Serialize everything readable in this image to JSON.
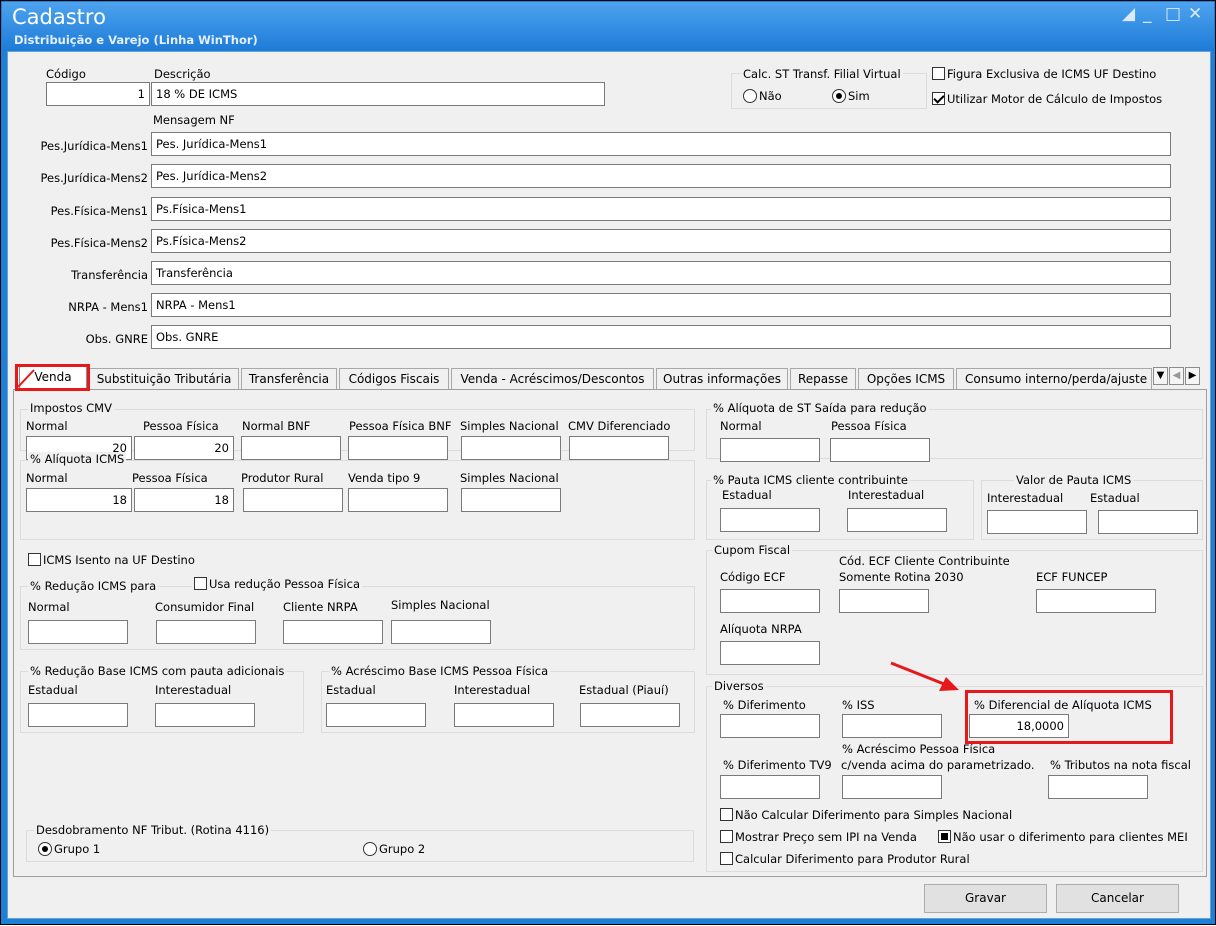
{
  "window": {
    "title": "Cadastro",
    "subtitle": "Distribuição e Varejo (Linha WinThor)"
  },
  "header": {
    "codigo_label": "Código",
    "codigo_value": "1",
    "descricao_label": "Descrição",
    "descricao_value": "18 % DE ICMS",
    "calc_st": {
      "label": "Calc. ST Transf. Filial Virtual",
      "options": [
        "Não",
        "Sim"
      ],
      "selected": "Sim"
    },
    "figura_exclusiva": {
      "label": "Figura Exclusiva de ICMS UF Destino",
      "checked": false
    },
    "utilizar_motor": {
      "label": "Utilizar Motor de Cálculo de Impostos",
      "checked": true
    },
    "mensagem_nf_label": "Mensagem NF"
  },
  "mensagens": [
    {
      "label": "Pes.Jurídica-Mens1",
      "value": "Pes. Jurídica-Mens1"
    },
    {
      "label": "Pes.Jurídica-Mens2",
      "value": "Pes. Jurídica-Mens2"
    },
    {
      "label": "Pes.Física-Mens1",
      "value": "Ps.Física-Mens1"
    },
    {
      "label": "Pes.Física-Mens2",
      "value": "Ps.Física-Mens2"
    },
    {
      "label": "Transferência",
      "value": "Transferência"
    },
    {
      "label": "NRPA - Mens1",
      "value": "NRPA - Mens1"
    },
    {
      "label": "Obs. GNRE",
      "value": "Obs. GNRE"
    }
  ],
  "tabs": [
    {
      "label": "Venda",
      "active": true
    },
    {
      "label": "Substituição Tributária"
    },
    {
      "label": "Transferência"
    },
    {
      "label": "Códigos Fiscais"
    },
    {
      "label": "Venda - Acréscimos/Descontos"
    },
    {
      "label": "Outras informações"
    },
    {
      "label": "Repasse"
    },
    {
      "label": "Opções ICMS"
    },
    {
      "label": "Consumo interno/perda/ajuste"
    }
  ],
  "tab_nav": {
    "dropdown_icon": "dropdown-arrow-icon",
    "prev_icon": "arrow-left-icon",
    "next_icon": "arrow-right-icon"
  },
  "venda": {
    "impostos_cmv": {
      "title": "Impostos CMV",
      "fields": [
        {
          "label": "Normal",
          "value": "20"
        },
        {
          "label": "Pessoa Física",
          "value": "20"
        },
        {
          "label": "Normal BNF",
          "value": ""
        },
        {
          "label": "Pessoa Física BNF",
          "value": ""
        },
        {
          "label": "Simples Nacional",
          "value": ""
        },
        {
          "label": "CMV Diferenciado",
          "value": ""
        }
      ]
    },
    "aliquota_icms": {
      "title": "% Alíquota ICMS",
      "fields": [
        {
          "label": "Normal",
          "value": "18"
        },
        {
          "label": "Pessoa Física",
          "value": "18"
        },
        {
          "label": "Produtor Rural",
          "value": ""
        },
        {
          "label": "Venda tipo 9",
          "value": ""
        },
        {
          "label": "Simples Nacional",
          "value": ""
        }
      ]
    },
    "icms_isento": {
      "label": "ICMS Isento na UF Destino",
      "checked": false
    },
    "reducao_icms": {
      "title": "% Redução ICMS para",
      "usa_reducao": {
        "label": "Usa redução Pessoa Física",
        "checked": false
      },
      "fields": [
        {
          "label": "Normal",
          "value": ""
        },
        {
          "label": "Consumidor Final",
          "value": ""
        },
        {
          "label": "Cliente NRPA",
          "value": ""
        },
        {
          "label": "Simples Nacional",
          "value": ""
        }
      ]
    },
    "reducao_base_pauta": {
      "title": "% Redução Base ICMS com pauta adicionais",
      "fields": [
        {
          "label": "Estadual",
          "value": ""
        },
        {
          "label": "Interestadual",
          "value": ""
        }
      ]
    },
    "acrescimo_base_pf": {
      "title": "% Acréscimo Base ICMS Pessoa Física",
      "fields": [
        {
          "label": "Estadual",
          "value": ""
        },
        {
          "label": "Interestadual",
          "value": ""
        },
        {
          "label": "Estadual (Piauí)",
          "value": ""
        }
      ]
    },
    "desdobramento": {
      "title": "Desdobramento NF Tribut. (Rotina 4116)",
      "options": [
        "Grupo 1",
        "Grupo 2"
      ],
      "selected": "Grupo 1"
    },
    "aliquota_st_reducao": {
      "title": "% Alíquota de ST Saída para redução",
      "fields": [
        {
          "label": "Normal",
          "value": ""
        },
        {
          "label": "Pessoa Física",
          "value": ""
        }
      ]
    },
    "pauta_contribuinte": {
      "title": "% Pauta ICMS cliente contribuinte",
      "fields": [
        {
          "label": "Estadual",
          "value": ""
        },
        {
          "label": "Interestadual",
          "value": ""
        }
      ]
    },
    "valor_pauta": {
      "title": "Valor de Pauta ICMS",
      "fields": [
        {
          "label": "Interestadual",
          "value": ""
        },
        {
          "label": "Estadual",
          "value": ""
        }
      ]
    },
    "cupom_fiscal": {
      "title": "Cupom Fiscal",
      "codigo_ecf": {
        "label": "Código ECF",
        "value": ""
      },
      "cod_ecf_contrib": {
        "label_line1": "Cód. ECF Cliente Contribuinte",
        "label_line2": "Somente Rotina 2030",
        "value": ""
      },
      "ecf_funcep": {
        "label": "ECF FUNCEP",
        "value": ""
      },
      "aliquota_nrpa": {
        "label": "Alíquota NRPA",
        "value": ""
      }
    },
    "diversos": {
      "title": "Diversos",
      "diferimento": {
        "label": "% Diferimento",
        "value": ""
      },
      "iss": {
        "label": "% ISS",
        "value": ""
      },
      "diferencial_aliquota": {
        "label": "% Diferencial de Alíquota ICMS",
        "value": "18,0000"
      },
      "diferimento_tv9": {
        "label": "% Diferimento TV9",
        "value": ""
      },
      "acrescimo_pf": {
        "label_line1": "% Acréscimo Pessoa Física",
        "label_line2": "c/venda acima do parametrizado.",
        "value": ""
      },
      "tributos_nota": {
        "label": "% Tributos na nota fiscal",
        "value": ""
      },
      "nao_calcular": {
        "label": "Não Calcular Diferimento para Simples Nacional",
        "checked": false
      },
      "mostrar_preco": {
        "label": "Mostrar Preço sem IPI na Venda",
        "checked": false
      },
      "nao_usar_mei": {
        "label": "Não usar o diferimento para clientes MEI",
        "checked": true
      },
      "calcular_produtor": {
        "label": "Calcular Diferimento para Produtor Rural",
        "checked": false
      }
    }
  },
  "footer": {
    "gravar": "Gravar",
    "cancelar": "Cancelar"
  },
  "annotation_color": "#e5191c"
}
